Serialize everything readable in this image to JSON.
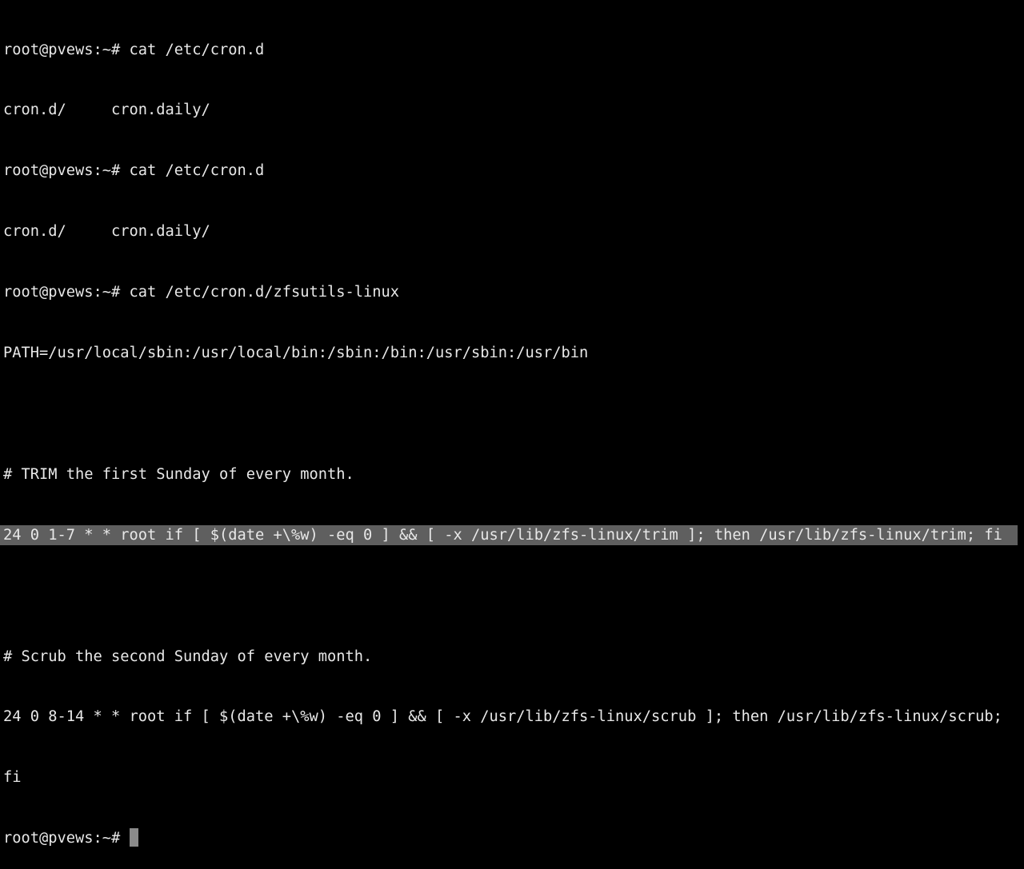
{
  "terminal": {
    "lines": [
      "root@pvews:~# cat /etc/cron.d",
      "cron.d/     cron.daily/",
      "root@pvews:~# cat /etc/cron.d",
      "cron.d/     cron.daily/",
      "root@pvews:~# cat /etc/cron.d/zfsutils-linux",
      "PATH=/usr/local/sbin:/usr/local/bin:/sbin:/bin:/usr/sbin:/usr/bin",
      "",
      "# TRIM the first Sunday of every month.",
      "24 0 1-7 * * root if [ $(date +\\%w) -eq 0 ] && [ -x /usr/lib/zfs-linux/trim ]; then /usr/lib/zfs-linux/trim; fi",
      "",
      "# Scrub the second Sunday of every month.",
      "24 0 8-14 * * root if [ $(date +\\%w) -eq 0 ] && [ -x /usr/lib/zfs-linux/scrub ]; then /usr/lib/zfs-linux/scrub;",
      "fi"
    ],
    "prompt": "root@pvews:~# ",
    "highlighted_line_index": 8,
    "colors": {
      "background": "#000000",
      "text": "#e8e8e8",
      "selection": "#5f5f5f",
      "cursor": "#8a8a8a"
    }
  }
}
